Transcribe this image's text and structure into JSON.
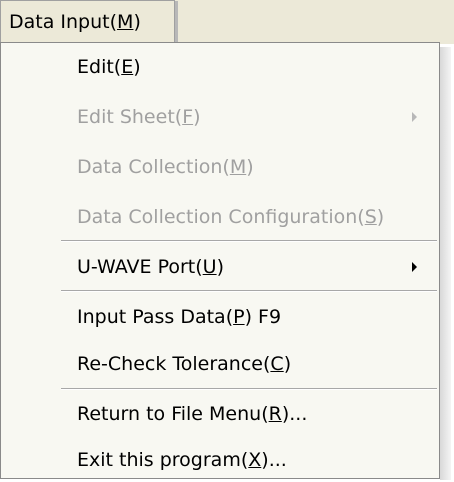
{
  "menubar": {
    "title_pre": "Data Input(",
    "title_accel": "M",
    "title_post": ")"
  },
  "menu": {
    "edit": {
      "pre": "Edit(",
      "accel": "E",
      "post": ")"
    },
    "edit_sheet": {
      "pre": "Edit Sheet(",
      "accel": "F",
      "post": ")"
    },
    "data_collection": {
      "pre": "Data Collection(",
      "accel": "M",
      "post": ")"
    },
    "data_collection_config": {
      "pre": "Data Collection Configuration(",
      "accel": "S",
      "post": ")"
    },
    "uwave_port": {
      "pre": "U-WAVE Port(",
      "accel": "U",
      "post": ")"
    },
    "input_pass_data": {
      "pre": "Input Pass Data(",
      "accel": "P",
      "post": ") F9"
    },
    "recheck_tolerance": {
      "pre": "Re-Check Tolerance(",
      "accel": "C",
      "post": ")"
    },
    "return_file_menu": {
      "pre": "Return to File Menu(",
      "accel": "R",
      "post": ")..."
    },
    "exit_program": {
      "pre": "Exit this program(",
      "accel": "X",
      "post": ")..."
    }
  },
  "icons": {
    "submenu": "triangle-right-icon"
  },
  "colors": {
    "menubar_bg": "#ece9d8",
    "menu_bg": "#f8f8f2",
    "disabled_text": "#a0a0a0",
    "separator": "#a8a8a8"
  }
}
